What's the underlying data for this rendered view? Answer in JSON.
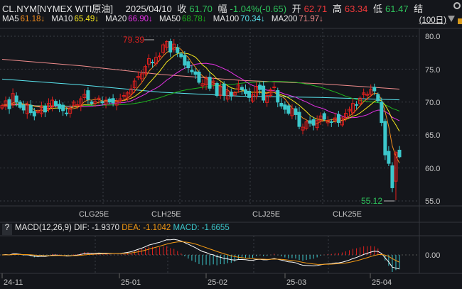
{
  "header": {
    "symbol": "CL.NYM[NYMEX WTI原油]",
    "date": "2025/04/10",
    "close_label": "收",
    "close": "61.70",
    "change_label": "幅",
    "change": "-1.04%(-0.65)",
    "open_label": "开",
    "open": "62.71",
    "high_label": "高",
    "high": "63.34",
    "low_label": "低",
    "low": "61.47",
    "settle_label": "结"
  },
  "ma": [
    {
      "label": "MA5",
      "value": "61.18↓",
      "color": "#f08c1e"
    },
    {
      "label": "MA10",
      "value": "65.49↓",
      "color": "#f5e61e"
    },
    {
      "label": "MA20",
      "value": "66.90↓",
      "color": "#e632e6"
    },
    {
      "label": "MA50",
      "value": "68.78↓",
      "color": "#1eb41e"
    },
    {
      "label": "MA100",
      "value": "70.34↓",
      "color": "#5ae6f0"
    },
    {
      "label": "MA200",
      "value": "71.97↓",
      "color": "#f08c8c"
    }
  ],
  "period": "(100日)",
  "annotations": {
    "high": "79.39",
    "low": "55.12"
  },
  "price_axis": [
    "80.0",
    "75.0",
    "70.0",
    "65.0",
    "60.0",
    "55.0"
  ],
  "contracts": [
    "CLG25E",
    "CLH25E",
    "CLJ25E",
    "CLK25E"
  ],
  "macd": {
    "help": "?",
    "title": "MACD(12,26,9)",
    "dif": "DIF: -1.9370",
    "dea": "DEA: -1.1042",
    "macd": "MACD: -1.6655",
    "zero": "0.00"
  },
  "dates": [
    "24-11",
    "25-01",
    "25-02",
    "25-03",
    "25-04"
  ],
  "colors": {
    "up": "#e0201e",
    "down": "#3cc8cc",
    "dif": "#ffffff",
    "dea": "#f59a14"
  },
  "chart_data": {
    "type": "candlestick",
    "ylim": [
      54,
      81
    ],
    "closes": [
      69.5,
      70.2,
      69.0,
      71.3,
      70.0,
      69.2,
      68.8,
      69.7,
      68.4,
      67.9,
      68.6,
      69.4,
      68.5,
      69.8,
      70.3,
      69.5,
      69.0,
      68.7,
      68.3,
      69.1,
      70.0,
      69.6,
      70.5,
      71.2,
      70.4,
      69.8,
      70.1,
      70.6,
      69.9,
      70.3,
      70.0,
      69.9,
      70.2,
      70.5,
      71.0,
      71.4,
      72.0,
      73.2,
      73.9,
      74.3,
      75.4,
      76.6,
      76.0,
      76.8,
      77.0,
      78.7,
      79.2,
      77.6,
      78.8,
      77.5,
      76.9,
      75.6,
      75.2,
      74.6,
      74.2,
      73.0,
      72.8,
      73.6,
      72.1,
      73.2,
      71.0,
      72.4,
      71.0,
      71.7,
      70.9,
      71.4,
      72.6,
      71.9,
      71.3,
      70.7,
      71.1,
      72.4,
      71.9,
      70.3,
      71.0,
      71.9,
      72.3,
      70.0,
      69.4,
      68.9,
      68.3,
      69.0,
      68.1,
      66.3,
      66.2,
      67.0,
      66.8,
      66.5,
      67.2,
      67.9,
      67.4,
      67.2,
      67.0,
      67.6,
      66.9,
      67.6,
      68.3,
      68.9,
      69.8,
      69.6,
      70.6,
      71.4,
      71.2,
      71.9,
      71.7,
      70.2,
      66.9,
      61.99,
      60.7,
      57.0,
      62.35,
      61.7
    ],
    "ma100": [
      73.5,
      72.6,
      71.5,
      70.9,
      70.7,
      70.34
    ],
    "ma200": [
      76.5,
      75.5,
      74.2,
      73.3,
      72.8,
      71.97
    ],
    "high": 79.39,
    "low": 55.12
  }
}
